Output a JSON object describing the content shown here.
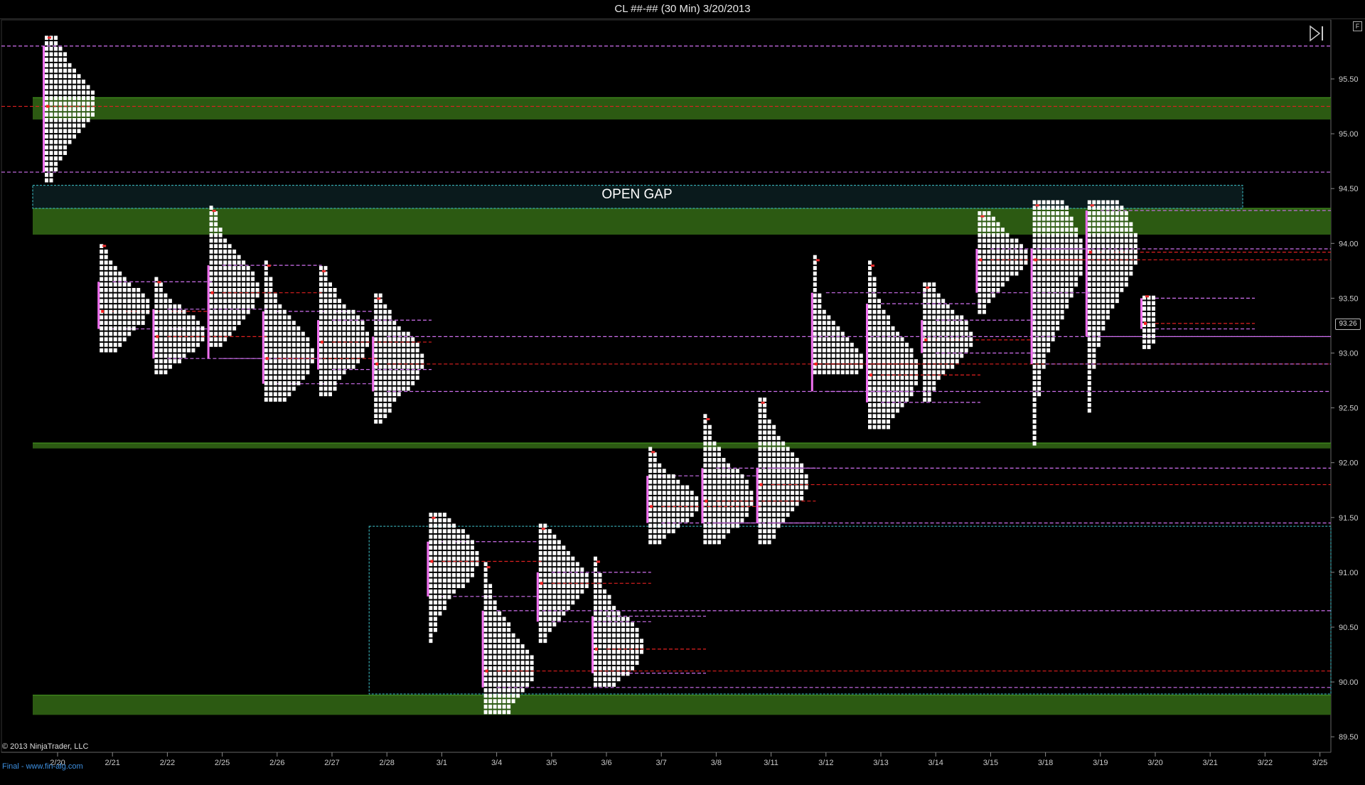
{
  "window": {
    "title": "CL ##-## (30 Min)  3/20/2013",
    "corner_button": "F"
  },
  "footer": {
    "copyright": "© 2013 NinjaTrader, LLC",
    "website": "Final - www.fin-alg.com"
  },
  "annotations": {
    "open_gap": "OPEN GAP",
    "last_price": "93.26"
  },
  "colors": {
    "background": "#000000",
    "profile_cells": "#ffffff",
    "value_area": "#ff80ff",
    "poc_line": "#e02020",
    "va_line": "#d070f0",
    "zone_fill": "#2c5a12",
    "zone_line": "#47a022",
    "gap_border": "#40c8d0",
    "initial_balance": "#f070f0"
  },
  "chart_data": {
    "type": "market_profile",
    "instrument": "CL ##-##",
    "interval": "30 Min",
    "date": "3/20/2013",
    "y_axis": {
      "ylim": [
        89.35,
        95.95
      ],
      "ticks": [
        "89.50",
        "90.00",
        "90.50",
        "91.00",
        "91.50",
        "92.00",
        "92.50",
        "93.00",
        "93.50",
        "94.00",
        "94.50",
        "95.00",
        "95.50"
      ]
    },
    "x_axis": {
      "ticks": [
        "2/20",
        "2/21",
        "2/22",
        "2/25",
        "2/26",
        "2/27",
        "2/28",
        "3/1",
        "3/4",
        "3/5",
        "3/6",
        "3/7",
        "3/8",
        "3/11",
        "3/12",
        "3/13",
        "3/14",
        "3/15",
        "3/18",
        "3/19",
        "3/20",
        "3/21",
        "3/22",
        "3/25"
      ]
    },
    "profiles": [
      {
        "session": "2/20",
        "high": 95.88,
        "low": 94.55,
        "poc": 95.25,
        "val": 94.65,
        "vah": 95.8
      },
      {
        "session": "2/21",
        "high": 93.98,
        "low": 93.0,
        "poc": 93.38,
        "val": 93.22,
        "vah": 93.65
      },
      {
        "session": "2/22",
        "high": 93.65,
        "low": 92.8,
        "poc": 93.15,
        "val": 92.95,
        "vah": 93.4
      },
      {
        "session": "2/25",
        "high": 94.3,
        "low": 93.05,
        "poc": 93.55,
        "val": 92.95,
        "vah": 93.8
      },
      {
        "session": "2/26",
        "high": 93.8,
        "low": 92.55,
        "poc": 92.95,
        "val": 92.72,
        "vah": 93.38
      },
      {
        "session": "2/27",
        "high": 93.75,
        "low": 92.6,
        "poc": 93.1,
        "val": 92.85,
        "vah": 93.3
      },
      {
        "session": "2/28",
        "high": 93.5,
        "low": 92.35,
        "poc": 92.9,
        "val": 92.65,
        "vah": 93.15
      },
      {
        "session": "3/1",
        "high": 91.5,
        "low": 90.35,
        "poc": 91.1,
        "val": 90.78,
        "vah": 91.28
      },
      {
        "session": "3/4",
        "high": 91.05,
        "low": 89.7,
        "poc": 90.1,
        "val": 89.95,
        "vah": 90.65
      },
      {
        "session": "3/5",
        "high": 91.4,
        "low": 90.35,
        "poc": 90.9,
        "val": 90.55,
        "vah": 91.0
      },
      {
        "session": "3/6",
        "high": 91.1,
        "low": 89.95,
        "poc": 90.3,
        "val": 90.08,
        "vah": 90.6
      },
      {
        "session": "3/7",
        "high": 92.1,
        "low": 91.25,
        "poc": 91.6,
        "val": 91.45,
        "vah": 91.88
      },
      {
        "session": "3/8",
        "high": 92.4,
        "low": 91.25,
        "poc": 91.65,
        "val": 91.45,
        "vah": 91.95
      },
      {
        "session": "3/11",
        "high": 92.55,
        "low": 91.25,
        "poc": 91.8,
        "val": 91.45,
        "vah": 91.95
      },
      {
        "session": "3/12",
        "high": 93.85,
        "low": 92.8,
        "poc": 92.9,
        "val": 92.65,
        "vah": 93.55
      },
      {
        "session": "3/13",
        "high": 93.8,
        "low": 92.3,
        "poc": 92.8,
        "val": 92.55,
        "vah": 93.45
      },
      {
        "session": "3/14",
        "high": 93.6,
        "low": 92.55,
        "poc": 93.12,
        "val": 93.0,
        "vah": 93.3
      },
      {
        "session": "3/15",
        "high": 94.25,
        "low": 93.35,
        "poc": 93.85,
        "val": 93.55,
        "vah": 93.95
      },
      {
        "session": "3/18",
        "high": 94.35,
        "low": 92.15,
        "poc": 93.85,
        "val": 92.9,
        "vah": 93.95
      },
      {
        "session": "3/19",
        "high": 94.35,
        "low": 92.45,
        "poc": 93.92,
        "val": 93.15,
        "vah": 94.3
      },
      {
        "session": "3/20",
        "high": 93.52,
        "low": 93.03,
        "poc": 93.27,
        "val": 93.22,
        "vah": 93.5
      }
    ],
    "zones": [
      {
        "from": 95.13,
        "to": 95.33
      },
      {
        "from": 94.08,
        "to": 94.32
      },
      {
        "from": 92.13,
        "to": 92.18
      },
      {
        "from": 89.7,
        "to": 89.88
      }
    ],
    "gap_boxes": [
      {
        "from_session": "2/20",
        "to_session": "3/21",
        "from": 94.32,
        "to": 94.53
      },
      {
        "from_session": "2/28",
        "to_session": "3/25",
        "from": 89.89,
        "to": 91.42
      }
    ]
  }
}
